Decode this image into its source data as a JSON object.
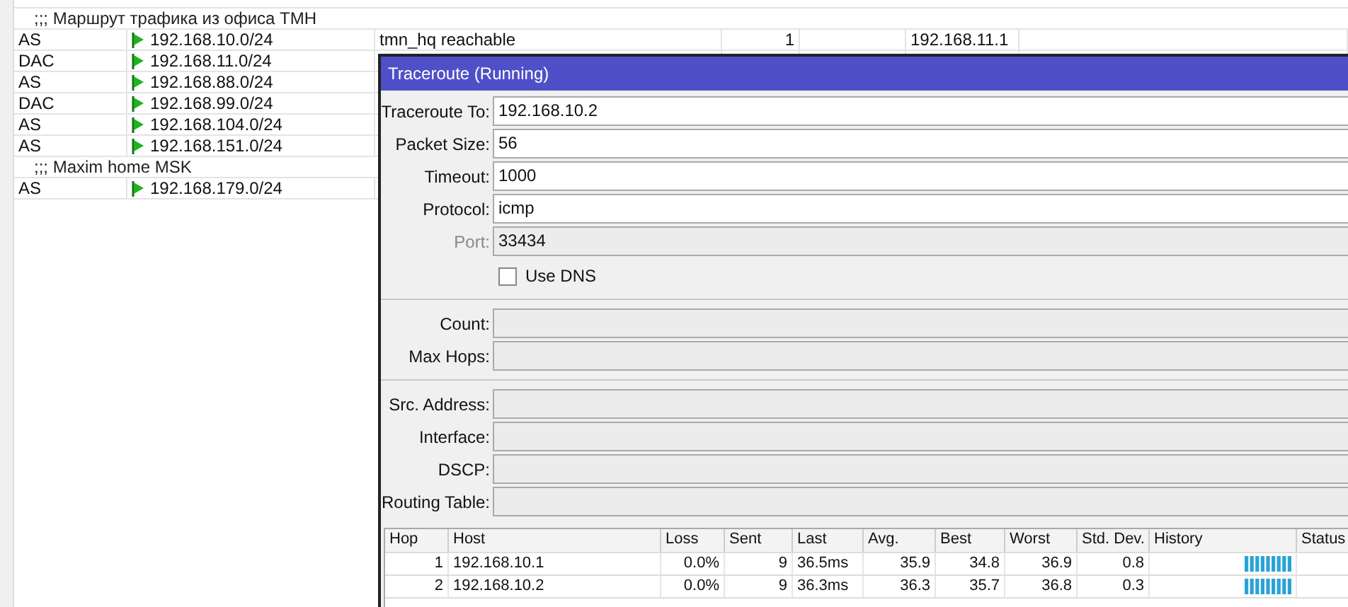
{
  "routes": [
    {
      "kind": "comment",
      "text": ";;; Маршрут трафика из офиса ТМН"
    },
    {
      "kind": "route",
      "type": "AS",
      "dst": "192.168.10.0/24",
      "comment": "tmn_hq reachable",
      "distance": "1",
      "gateway": "192.168.11.1"
    },
    {
      "kind": "route",
      "type": "DAC",
      "dst": "192.168.11.0/24"
    },
    {
      "kind": "route",
      "type": "AS",
      "dst": "192.168.88.0/24"
    },
    {
      "kind": "route",
      "type": "DAC",
      "dst": "192.168.99.0/24"
    },
    {
      "kind": "route",
      "type": "AS",
      "dst": "192.168.104.0/24"
    },
    {
      "kind": "route",
      "type": "AS",
      "dst": "192.168.151.0/24"
    },
    {
      "kind": "comment",
      "text": ";;; Maxim home MSK"
    },
    {
      "kind": "route",
      "type": "AS",
      "dst": "192.168.179.0/24"
    }
  ],
  "dialog": {
    "title": "Traceroute (Running)",
    "fields": [
      {
        "kind": "text",
        "label": "Traceroute To:",
        "value": "192.168.10.2",
        "disabled": false
      },
      {
        "kind": "text",
        "label": "Packet Size:",
        "value": "56",
        "disabled": false
      },
      {
        "kind": "text",
        "label": "Timeout:",
        "value": "1000",
        "disabled": false
      },
      {
        "kind": "text",
        "label": "Protocol:",
        "value": "icmp",
        "disabled": false
      },
      {
        "kind": "text",
        "label": "Port:",
        "value": "33434",
        "disabled": true
      },
      {
        "kind": "checkbox",
        "label": "Use DNS",
        "checked": false
      },
      {
        "kind": "separator"
      },
      {
        "kind": "text",
        "label": "Count:",
        "disabled": true
      },
      {
        "kind": "text",
        "label": "Max Hops:",
        "disabled": true
      },
      {
        "kind": "separator"
      },
      {
        "kind": "text",
        "label": "Src. Address:",
        "disabled": true
      },
      {
        "kind": "text",
        "label": "Interface:",
        "disabled": true
      },
      {
        "kind": "text",
        "label": "DSCP:",
        "disabled": true
      },
      {
        "kind": "text",
        "label": "Routing Table:",
        "disabled": true
      }
    ],
    "table": {
      "columns": [
        "Hop",
        "Host",
        "Loss",
        "Sent",
        "Last",
        "Avg.",
        "Best",
        "Worst",
        "Std. Dev.",
        "History",
        "Status"
      ],
      "rows": [
        {
          "hop": "1",
          "host": "192.168.10.1",
          "loss": "0.0%",
          "sent": "9",
          "last": "36.5ms",
          "avg": "35.9",
          "best": "34.8",
          "worst": "36.9",
          "std": "0.8"
        },
        {
          "hop": "2",
          "host": "192.168.10.2",
          "loss": "0.0%",
          "sent": "9",
          "last": "36.3ms",
          "avg": "36.3",
          "best": "35.7",
          "worst": "36.8",
          "std": "0.3"
        }
      ]
    }
  }
}
